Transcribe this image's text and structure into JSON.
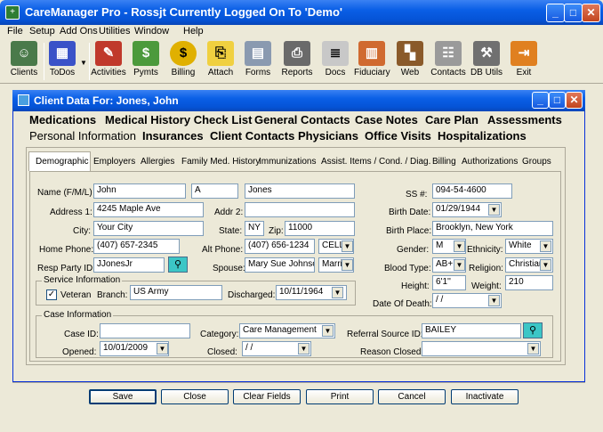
{
  "window": {
    "title": "CareManager Pro - Rossjt Currently Logged On To 'Demo'"
  },
  "menu": [
    "File",
    "Setup",
    "Add Ons",
    "Utilities",
    "Window",
    "Help"
  ],
  "toolbar": [
    {
      "label": "Clients",
      "icon": "clients-icon"
    },
    {
      "label": "ToDos",
      "icon": "todos-icon"
    },
    {
      "label": "Activities",
      "icon": "activities-icon"
    },
    {
      "label": "Pymts",
      "icon": "payments-icon"
    },
    {
      "label": "Billing",
      "icon": "billing-icon"
    },
    {
      "label": "Attach",
      "icon": "attach-icon"
    },
    {
      "label": "Forms",
      "icon": "forms-icon"
    },
    {
      "label": "Reports",
      "icon": "reports-icon"
    },
    {
      "label": "Docs",
      "icon": "docs-icon"
    },
    {
      "label": "Fiduciary",
      "icon": "fiduciary-icon"
    },
    {
      "label": "Web",
      "icon": "web-icon"
    },
    {
      "label": "Contacts",
      "icon": "contacts-icon"
    },
    {
      "label": "DB Utils",
      "icon": "db-utils-icon"
    },
    {
      "label": "Exit",
      "icon": "exit-icon"
    }
  ],
  "client_window": {
    "title": "Client Data For: Jones, John"
  },
  "main_tabs_row1": [
    "Medications",
    "Medical History Check List",
    "General Contacts",
    "Case Notes",
    "Care Plan",
    "Assessments"
  ],
  "main_tabs_row2": [
    "Personal Information",
    "Insurances",
    "Client Contacts",
    "Physicians",
    "Office Visits",
    "Hospitalizations"
  ],
  "sub_tabs": [
    "Demographic",
    "Employers",
    "Allergies",
    "Family Med. History",
    "Immunizations",
    "Assist. Items / Cond. / Diag.",
    "Billing",
    "Authorizations",
    "Groups"
  ],
  "form": {
    "name_label": "Name (F/M/L)",
    "first": "John",
    "middle": "A",
    "last": "Jones",
    "address1_label": "Address 1:",
    "address1": "4245 Maple Ave",
    "addr2_label": "Addr 2:",
    "addr2": "",
    "city_label": "City:",
    "city": "Your City",
    "state_label": "State:",
    "state": "NY",
    "zip_label": "Zip:",
    "zip": "11000",
    "home_phone_label": "Home Phone:",
    "home_phone": "(407) 657-2345",
    "alt_phone_label": "Alt Phone:",
    "alt_phone": "(407) 656-1234",
    "alt_phone_type": "CELL",
    "resp_party_label": "Resp Party ID:",
    "resp_party": "JJonesJr",
    "spouse_label": "Spouse:",
    "spouse": "Mary Sue Johnso",
    "marital": "Marri",
    "ssn_label": "SS #:",
    "ssn": "094-54-4600",
    "birth_date_label": "Birth Date:",
    "birth_date": "01/29/1944",
    "birth_place_label": "Birth Place:",
    "birth_place": "Brooklyn, New York",
    "gender_label": "Gender:",
    "gender": "M",
    "ethnicity_label": "Ethnicity:",
    "ethnicity": "White",
    "blood_type_label": "Blood Type:",
    "blood_type": "AB+",
    "religion_label": "Religion:",
    "religion": "Christian",
    "height_label": "Height:",
    "height": "6'1''",
    "weight_label": "Weight:",
    "weight": "210",
    "date_of_death_label": "Date Of Death:",
    "date_of_death": " / /",
    "service_group": "Service Information",
    "veteran_label": "Veteran",
    "branch_label": "Branch:",
    "branch": "US Army",
    "discharged_label": "Discharged:",
    "discharged": "10/11/1964",
    "case_group": "Case Information",
    "case_id_label": "Case ID:",
    "case_id": "",
    "category_label": "Category:",
    "category": "Care Management",
    "referral_label": "Referral Source ID:",
    "referral": "BAILEY",
    "opened_label": "Opened:",
    "opened": "10/01/2009",
    "closed_label": "Closed:",
    "closed": " / /",
    "reason_closed_label": "Reason Closed:",
    "reason_closed": ""
  },
  "buttons": [
    "Save",
    "Close",
    "Clear Fields",
    "Print",
    "Cancel",
    "Inactivate"
  ]
}
